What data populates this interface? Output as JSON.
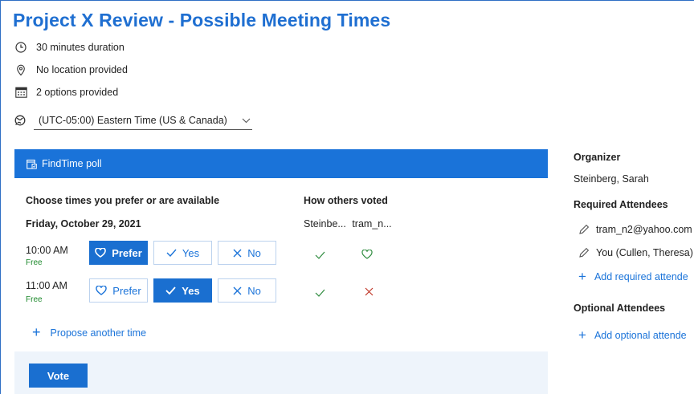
{
  "header": {
    "title": "Project X Review - Possible Meeting Times",
    "duration": "30 minutes duration",
    "location": "No location provided",
    "options": "2 options provided",
    "timezone": "(UTC-05:00) Eastern Time (US & Canada)"
  },
  "poll": {
    "header_label": "FindTime poll",
    "choose_heading": "Choose times you prefer or are available",
    "others_heading": "How others voted",
    "date": "Friday, October 29, 2021",
    "voters": [
      "Steinbe...",
      "tram_n..."
    ],
    "slots": [
      {
        "time": "10:00 AM",
        "status": "Free",
        "selected": "Prefer",
        "buttons": {
          "prefer": "Prefer",
          "yes": "Yes",
          "no": "No"
        },
        "votes": [
          "check-icon",
          "heart-icon"
        ]
      },
      {
        "time": "11:00 AM",
        "status": "Free",
        "selected": "Yes",
        "buttons": {
          "prefer": "Prefer",
          "yes": "Yes",
          "no": "No"
        },
        "votes": [
          "check-icon",
          "x-icon"
        ]
      }
    ],
    "propose_label": "Propose another time",
    "vote_label": "Vote"
  },
  "sidebar": {
    "organizer_heading": "Organizer",
    "organizer": "Steinberg, Sarah",
    "required_heading": "Required Attendees",
    "required": [
      "tram_n2@yahoo.com",
      "You (Cullen, Theresa)"
    ],
    "add_required": "Add required attende",
    "optional_heading": "Optional Attendees",
    "add_optional": "Add optional attende"
  },
  "colors": {
    "accent": "#1a73d9",
    "free": "#1e8a2d",
    "check": "#2e8b3e",
    "x": "#c0392b"
  }
}
